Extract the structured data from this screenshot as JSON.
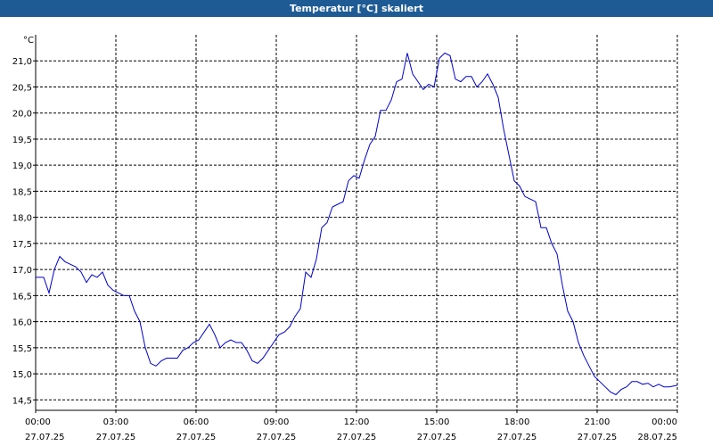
{
  "window": {
    "title": "Temperatur [°C] skaliert"
  },
  "colors": {
    "titlebar": "#1e5b95",
    "line": "#0000cc",
    "grid": "#000000",
    "background": "#ffffff"
  },
  "chart_data": {
    "type": "line",
    "title": "Temperatur [°C] skaliert",
    "ylabel": "°C",
    "xlabel": "",
    "ylim": [
      14.3,
      21.5
    ],
    "xlim": [
      0,
      24
    ],
    "grid": true,
    "x_ticks": [
      {
        "time": "00:00",
        "date": "27.07.25"
      },
      {
        "time": "03:00",
        "date": "27.07.25"
      },
      {
        "time": "06:00",
        "date": "27.07.25"
      },
      {
        "time": "09:00",
        "date": "27.07.25"
      },
      {
        "time": "12:00",
        "date": "27.07.25"
      },
      {
        "time": "15:00",
        "date": "27.07.25"
      },
      {
        "time": "18:00",
        "date": "27.07.25"
      },
      {
        "time": "21:00",
        "date": "27.07.25"
      },
      {
        "time": "00:00",
        "date": "28.07.25"
      }
    ],
    "y_ticks": [
      "14,5",
      "15,0",
      "15,5",
      "16,0",
      "16,5",
      "17,0",
      "17,5",
      "18,0",
      "18,5",
      "19,0",
      "19,5",
      "20,0",
      "20,5",
      "21,0"
    ],
    "series": [
      {
        "x": [
          0,
          0.3,
          0.5,
          0.7,
          0.9,
          1.1,
          1.3,
          1.5,
          1.7,
          1.9,
          2.1,
          2.3,
          2.5,
          2.7,
          2.9,
          3.1,
          3.3,
          3.5,
          3.7,
          3.9,
          4.1,
          4.3,
          4.5,
          4.7,
          4.9,
          5.1,
          5.3,
          5.5,
          5.7,
          5.9,
          6.1,
          6.3,
          6.5,
          6.7,
          6.9,
          7.1,
          7.3,
          7.5,
          7.7,
          7.9,
          8.1,
          8.3,
          8.5,
          8.7,
          8.9,
          9.1,
          9.3,
          9.5,
          9.7,
          9.9,
          10.1,
          10.3,
          10.5,
          10.7,
          10.9,
          11.1,
          11.3,
          11.5,
          11.7,
          11.9,
          12.1,
          12.3,
          12.5,
          12.7,
          12.9,
          13.1,
          13.3,
          13.5,
          13.7,
          13.9,
          14.1,
          14.3,
          14.5,
          14.7,
          14.9,
          15.1,
          15.3,
          15.5,
          15.7,
          15.9,
          16.1,
          16.3,
          16.5,
          16.7,
          16.9,
          17.1,
          17.3,
          17.5,
          17.7,
          17.9,
          18.1,
          18.3,
          18.5,
          18.7,
          18.9,
          19.1,
          19.3,
          19.5,
          19.7,
          19.9,
          20.1,
          20.3,
          20.5,
          20.7,
          20.9,
          21.1,
          21.3,
          21.5,
          21.7,
          21.9,
          22.1,
          22.3,
          22.5,
          22.7,
          22.9,
          23.1,
          23.3,
          23.5,
          23.7,
          24
        ],
        "y": [
          16.85,
          16.85,
          16.55,
          17.0,
          17.25,
          17.15,
          17.1,
          17.05,
          16.95,
          16.75,
          16.9,
          16.85,
          16.95,
          16.7,
          16.6,
          16.55,
          16.5,
          16.5,
          16.2,
          16.0,
          15.5,
          15.2,
          15.15,
          15.25,
          15.3,
          15.3,
          15.3,
          15.45,
          15.5,
          15.6,
          15.65,
          15.8,
          15.95,
          15.75,
          15.5,
          15.6,
          15.65,
          15.6,
          15.6,
          15.45,
          15.25,
          15.2,
          15.3,
          15.45,
          15.6,
          15.75,
          15.8,
          15.9,
          16.1,
          16.25,
          16.95,
          16.85,
          17.2,
          17.8,
          17.9,
          18.2,
          18.25,
          18.3,
          18.7,
          18.8,
          18.75,
          19.1,
          19.4,
          19.55,
          20.05,
          20.05,
          20.25,
          20.6,
          20.65,
          21.15,
          20.75,
          20.6,
          20.45,
          20.55,
          20.5,
          21.05,
          21.15,
          21.1,
          20.65,
          20.6,
          20.7,
          20.7,
          20.5,
          20.6,
          20.75,
          20.55,
          20.3,
          19.7,
          19.2,
          18.7,
          18.6,
          18.4,
          18.35,
          18.3,
          17.8,
          17.8,
          17.5,
          17.3,
          16.7,
          16.2,
          16.0,
          15.6,
          15.35,
          15.15,
          14.95,
          14.85,
          14.75,
          14.65,
          14.6,
          14.7,
          14.75,
          14.85,
          14.85,
          14.8,
          14.82,
          14.75,
          14.8,
          14.75,
          14.75,
          14.78
        ]
      }
    ]
  }
}
